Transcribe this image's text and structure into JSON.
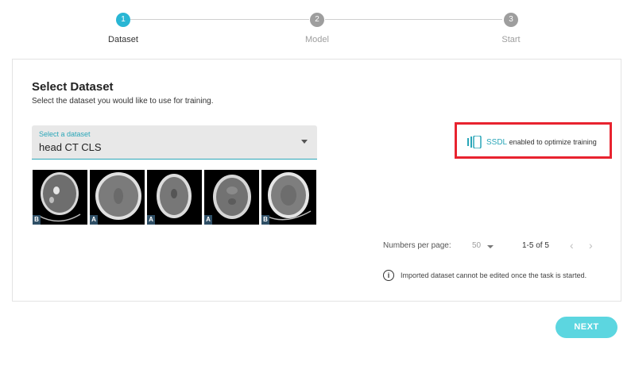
{
  "stepper": {
    "steps": [
      {
        "number": "1",
        "label": "Dataset",
        "state": "active"
      },
      {
        "number": "2",
        "label": "Model",
        "state": "inactive"
      },
      {
        "number": "3",
        "label": "Start",
        "state": "inactive"
      }
    ],
    "active_color": "#29b6d4",
    "inactive_color": "#9e9e9e"
  },
  "card": {
    "title": "Select Dataset",
    "subtitle": "Select the dataset you would like to use for training."
  },
  "dataset_select": {
    "label": "Select a dataset",
    "value": "head CT CLS",
    "icon": "caret-down-icon"
  },
  "thumbnails": [
    {
      "badge": "B"
    },
    {
      "badge": "A"
    },
    {
      "badge": "A"
    },
    {
      "badge": "A"
    },
    {
      "badge": "B"
    }
  ],
  "ssdl": {
    "icon": "ssdl-icon",
    "link": "SSDL",
    "text": "enabled to optimize training",
    "highlight_color": "#e8232f"
  },
  "pagination": {
    "label": "Numbers per page:",
    "per_page": "50",
    "range": "1-5 of 5",
    "prev_icon": "chevron-left-icon",
    "next_icon": "chevron-right-icon"
  },
  "info": {
    "icon": "info-icon",
    "text": "Imported dataset cannot be edited once the task is started."
  },
  "actions": {
    "next_label": "NEXT",
    "next_color": "#5cd6e0"
  }
}
